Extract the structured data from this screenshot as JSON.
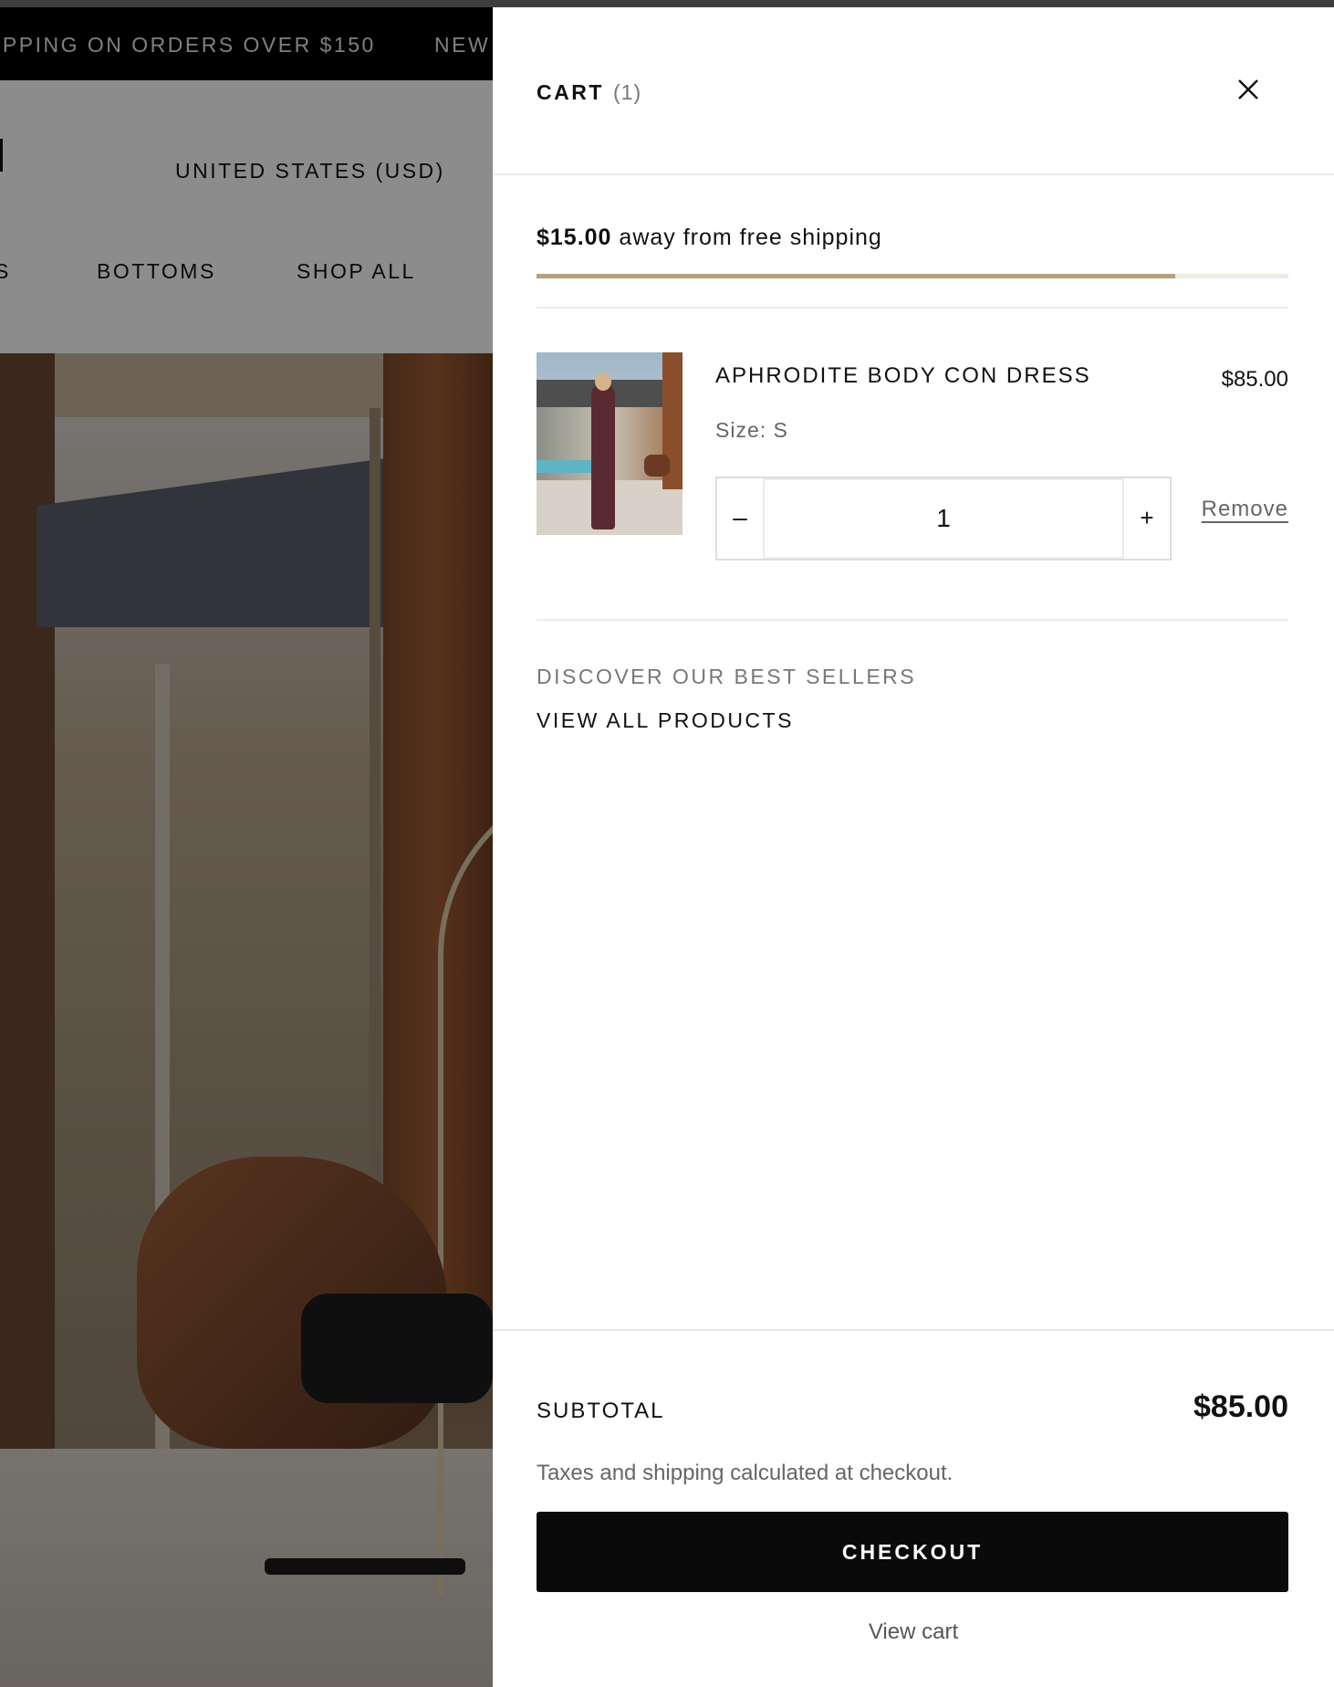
{
  "background_page": {
    "announcement": {
      "text_1": "IPPING ON ORDERS OVER $150",
      "text_2": "NEW"
    },
    "country_selector": "UNITED STATES (USD)",
    "nav": {
      "partial_item": "S",
      "bottoms": "BOTTOMS",
      "shop_all": "SHOP ALL"
    }
  },
  "cart": {
    "title": "CART",
    "count": "(1)",
    "close_icon": "close-icon",
    "free_shipping": {
      "amount_away": "$15.00",
      "text": "away from free shipping",
      "progress_fraction": 0.85,
      "bar_color": "#b5a27c"
    },
    "items": [
      {
        "name": "APHRODITE BODY CON DRESS",
        "price": "$85.00",
        "size": "Size: S",
        "quantity": "1",
        "minus_label": "–",
        "plus_label": "+",
        "remove_label": "Remove"
      }
    ],
    "discover_heading": "DISCOVER OUR BEST SELLERS",
    "view_all_link": "VIEW ALL PRODUCTS",
    "subtotal_label": "SUBTOTAL",
    "subtotal_value": "$85.00",
    "taxes_note": "Taxes and shipping calculated at checkout.",
    "checkout_label": "CHECKOUT",
    "view_cart_label": "View cart"
  }
}
